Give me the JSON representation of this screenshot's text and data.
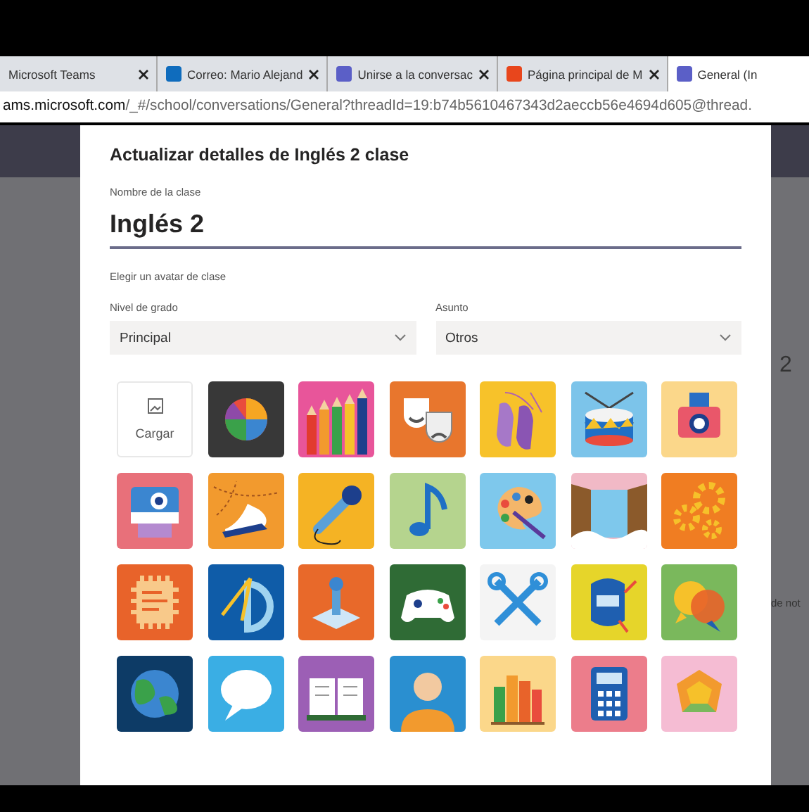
{
  "browser": {
    "tabs": [
      {
        "label": "Microsoft Teams",
        "selected": false
      },
      {
        "label": "Correo: Mario Alejand",
        "selected": false,
        "color": "#0f6cbd"
      },
      {
        "label": "Unirse a la conversac",
        "selected": false,
        "color": "#5b5fc7"
      },
      {
        "label": "Página principal de M",
        "selected": false,
        "color": "#e8461c"
      },
      {
        "label": "General (In",
        "selected": true,
        "color": "#5b5fc7"
      }
    ],
    "url": {
      "host": "ams.microsoft.com",
      "path": "/_#/school/conversations/General?threadId=19:b74b5610467343d2aeccb56e4694d605@thread."
    }
  },
  "background": {
    "texts": [
      "2",
      "de not"
    ]
  },
  "dialog": {
    "title": "Actualizar detalles de Inglés 2 clase",
    "name_field": {
      "label": "Nombre de la clase",
      "value": "Inglés 2"
    },
    "avatar_heading": "Elegir un avatar de clase",
    "dropdowns": [
      {
        "label": "Nivel de grado",
        "value": "Principal"
      },
      {
        "label": "Asunto",
        "value": "Otros"
      }
    ],
    "avatars": [
      {
        "kind": "upload",
        "label": "Cargar"
      },
      {
        "kind": "image",
        "color": "#383838"
      },
      {
        "kind": "image",
        "color": "#e8559a"
      },
      {
        "kind": "image",
        "color": "#e8762d"
      },
      {
        "kind": "image",
        "color": "#f7c22a"
      },
      {
        "kind": "image",
        "color": "#7cc4ea"
      },
      {
        "kind": "image",
        "color": "#fbd78a"
      },
      {
        "kind": "image",
        "color": "#e8707a"
      },
      {
        "kind": "image",
        "color": "#f29a2e"
      },
      {
        "kind": "image",
        "color": "#f5b324"
      },
      {
        "kind": "image",
        "color": "#b5d48e"
      },
      {
        "kind": "image",
        "color": "#7ec8ec"
      },
      {
        "kind": "image",
        "color": "#f1b9c6"
      },
      {
        "kind": "image",
        "color": "#f07d22"
      },
      {
        "kind": "image",
        "color": "#e8632a"
      },
      {
        "kind": "image",
        "color": "#0f5ca8"
      },
      {
        "kind": "image",
        "color": "#e8692a"
      },
      {
        "kind": "image",
        "color": "#2f6b35"
      },
      {
        "kind": "image",
        "color": "#f4f4f4"
      },
      {
        "kind": "image",
        "color": "#e6d52a"
      },
      {
        "kind": "image",
        "color": "#7ab85c"
      },
      {
        "kind": "image",
        "color": "#0d3b66"
      },
      {
        "kind": "image",
        "color": "#3aaee4"
      },
      {
        "kind": "image",
        "color": "#9c5fb5"
      },
      {
        "kind": "image",
        "color": "#2a8fd0"
      },
      {
        "kind": "image",
        "color": "#fbd78a"
      },
      {
        "kind": "image",
        "color": "#ec7d8b"
      },
      {
        "kind": "image",
        "color": "#f5bcd3"
      }
    ]
  }
}
